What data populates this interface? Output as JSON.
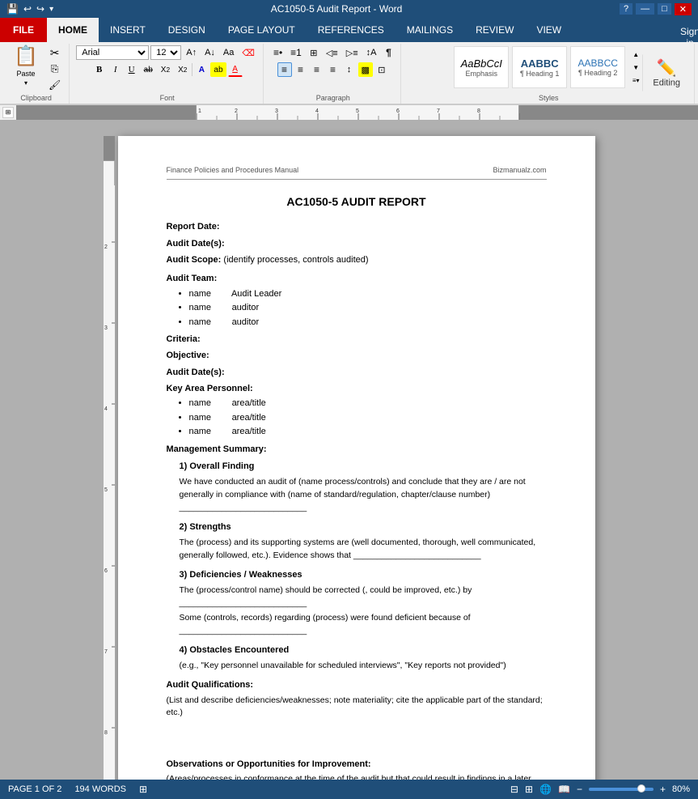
{
  "titlebar": {
    "title": "AC1050-5 Audit Report - Word",
    "help_icon": "?",
    "minimize": "—",
    "restore": "□",
    "close": "✕"
  },
  "tabs": [
    {
      "label": "FILE",
      "id": "file",
      "active": false
    },
    {
      "label": "HOME",
      "id": "home",
      "active": true
    },
    {
      "label": "INSERT",
      "id": "insert",
      "active": false
    },
    {
      "label": "DESIGN",
      "id": "design",
      "active": false
    },
    {
      "label": "PAGE LAYOUT",
      "id": "page_layout",
      "active": false
    },
    {
      "label": "REFERENCES",
      "id": "references",
      "active": false
    },
    {
      "label": "MAILINGS",
      "id": "mailings",
      "active": false
    },
    {
      "label": "REVIEW",
      "id": "review",
      "active": false
    },
    {
      "label": "VIEW",
      "id": "view",
      "active": false
    }
  ],
  "toolbar": {
    "clipboard_label": "Clipboard",
    "font_label": "Font",
    "paragraph_label": "Paragraph",
    "styles_label": "Styles",
    "paste_label": "Paste",
    "cut_label": "✂",
    "copy_label": "⎘",
    "format_painter_label": "🖌",
    "font_name": "Arial",
    "font_size": "12",
    "bold": "B",
    "italic": "I",
    "underline": "U",
    "strikethrough": "ab",
    "subscript": "X₂",
    "superscript": "X²",
    "font_color": "A",
    "text_highlight": "ab",
    "styles": [
      {
        "name": "AaBbCcI",
        "label": "Emphasis"
      },
      {
        "name": "AABBC",
        "label": "¶ Heading 1"
      },
      {
        "name": "AABBCC",
        "label": "¶ Heading 2"
      }
    ]
  },
  "editing": {
    "label": "Editing",
    "icon": "✏️"
  },
  "sign_in": "Sign in",
  "document": {
    "header_left": "Finance Policies and Procedures Manual",
    "header_right": "Bizmanualz.com",
    "title": "AC1050-5 AUDIT REPORT",
    "fields": [
      {
        "label": "Report Date:",
        "value": ""
      },
      {
        "label": "Audit Date(s):",
        "value": ""
      },
      {
        "label": "Audit Scope:",
        "value": "(identify processes, controls audited)"
      }
    ],
    "audit_team_label": "Audit Team:",
    "audit_team_members": [
      {
        "name": "name",
        "role": "Audit Leader"
      },
      {
        "name": "name",
        "role": "auditor"
      },
      {
        "name": "name",
        "role": "auditor"
      }
    ],
    "criteria_label": "Criteria:",
    "objective_label": "Objective:",
    "audit_dates_label": "Audit Date(s):",
    "key_area_label": "Key Area Personnel:",
    "key_area_members": [
      {
        "name": "name",
        "role": "area/title"
      },
      {
        "name": "name",
        "role": "area/title"
      },
      {
        "name": "name",
        "role": "area/title"
      }
    ],
    "management_summary_label": "Management Summary:",
    "sections": [
      {
        "title": "1) Overall Finding",
        "text": "We have conducted an audit of (name process/controls) and conclude that they are / are not generally in compliance with (name of standard/regulation, chapter/clause number) ___________________________"
      },
      {
        "title": "2) Strengths",
        "text": "The (process) and its supporting systems are (well documented, thorough, well communicated, generally followed, etc.).  Evidence shows that ___________________________"
      },
      {
        "title": "3) Deficiencies / Weaknesses",
        "text1": "The (process/control name) should be corrected (, could be improved, etc.) by ___________________________",
        "text2": "Some (controls, records) regarding (process) were found deficient because of ___________________________"
      },
      {
        "title": "4) Obstacles Encountered",
        "text": "(e.g., \"Key personnel unavailable for scheduled interviews\", \"Key reports not provided\")"
      }
    ],
    "audit_qualifications_label": "Audit Qualifications:",
    "audit_qualifications_text": "(List and describe deficiencies/weaknesses; note materiality; cite the applicable part of the standard; etc.)",
    "observations_label": "Observations or Opportunities for Improvement:",
    "observations_text": "(Areas/processes in conformance at the time of the audit but that could result in findings in a later audit if not addressed by the Company.)"
  },
  "statusbar": {
    "page": "PAGE 1 OF 2",
    "words": "194 WORDS",
    "zoom": "80%"
  }
}
